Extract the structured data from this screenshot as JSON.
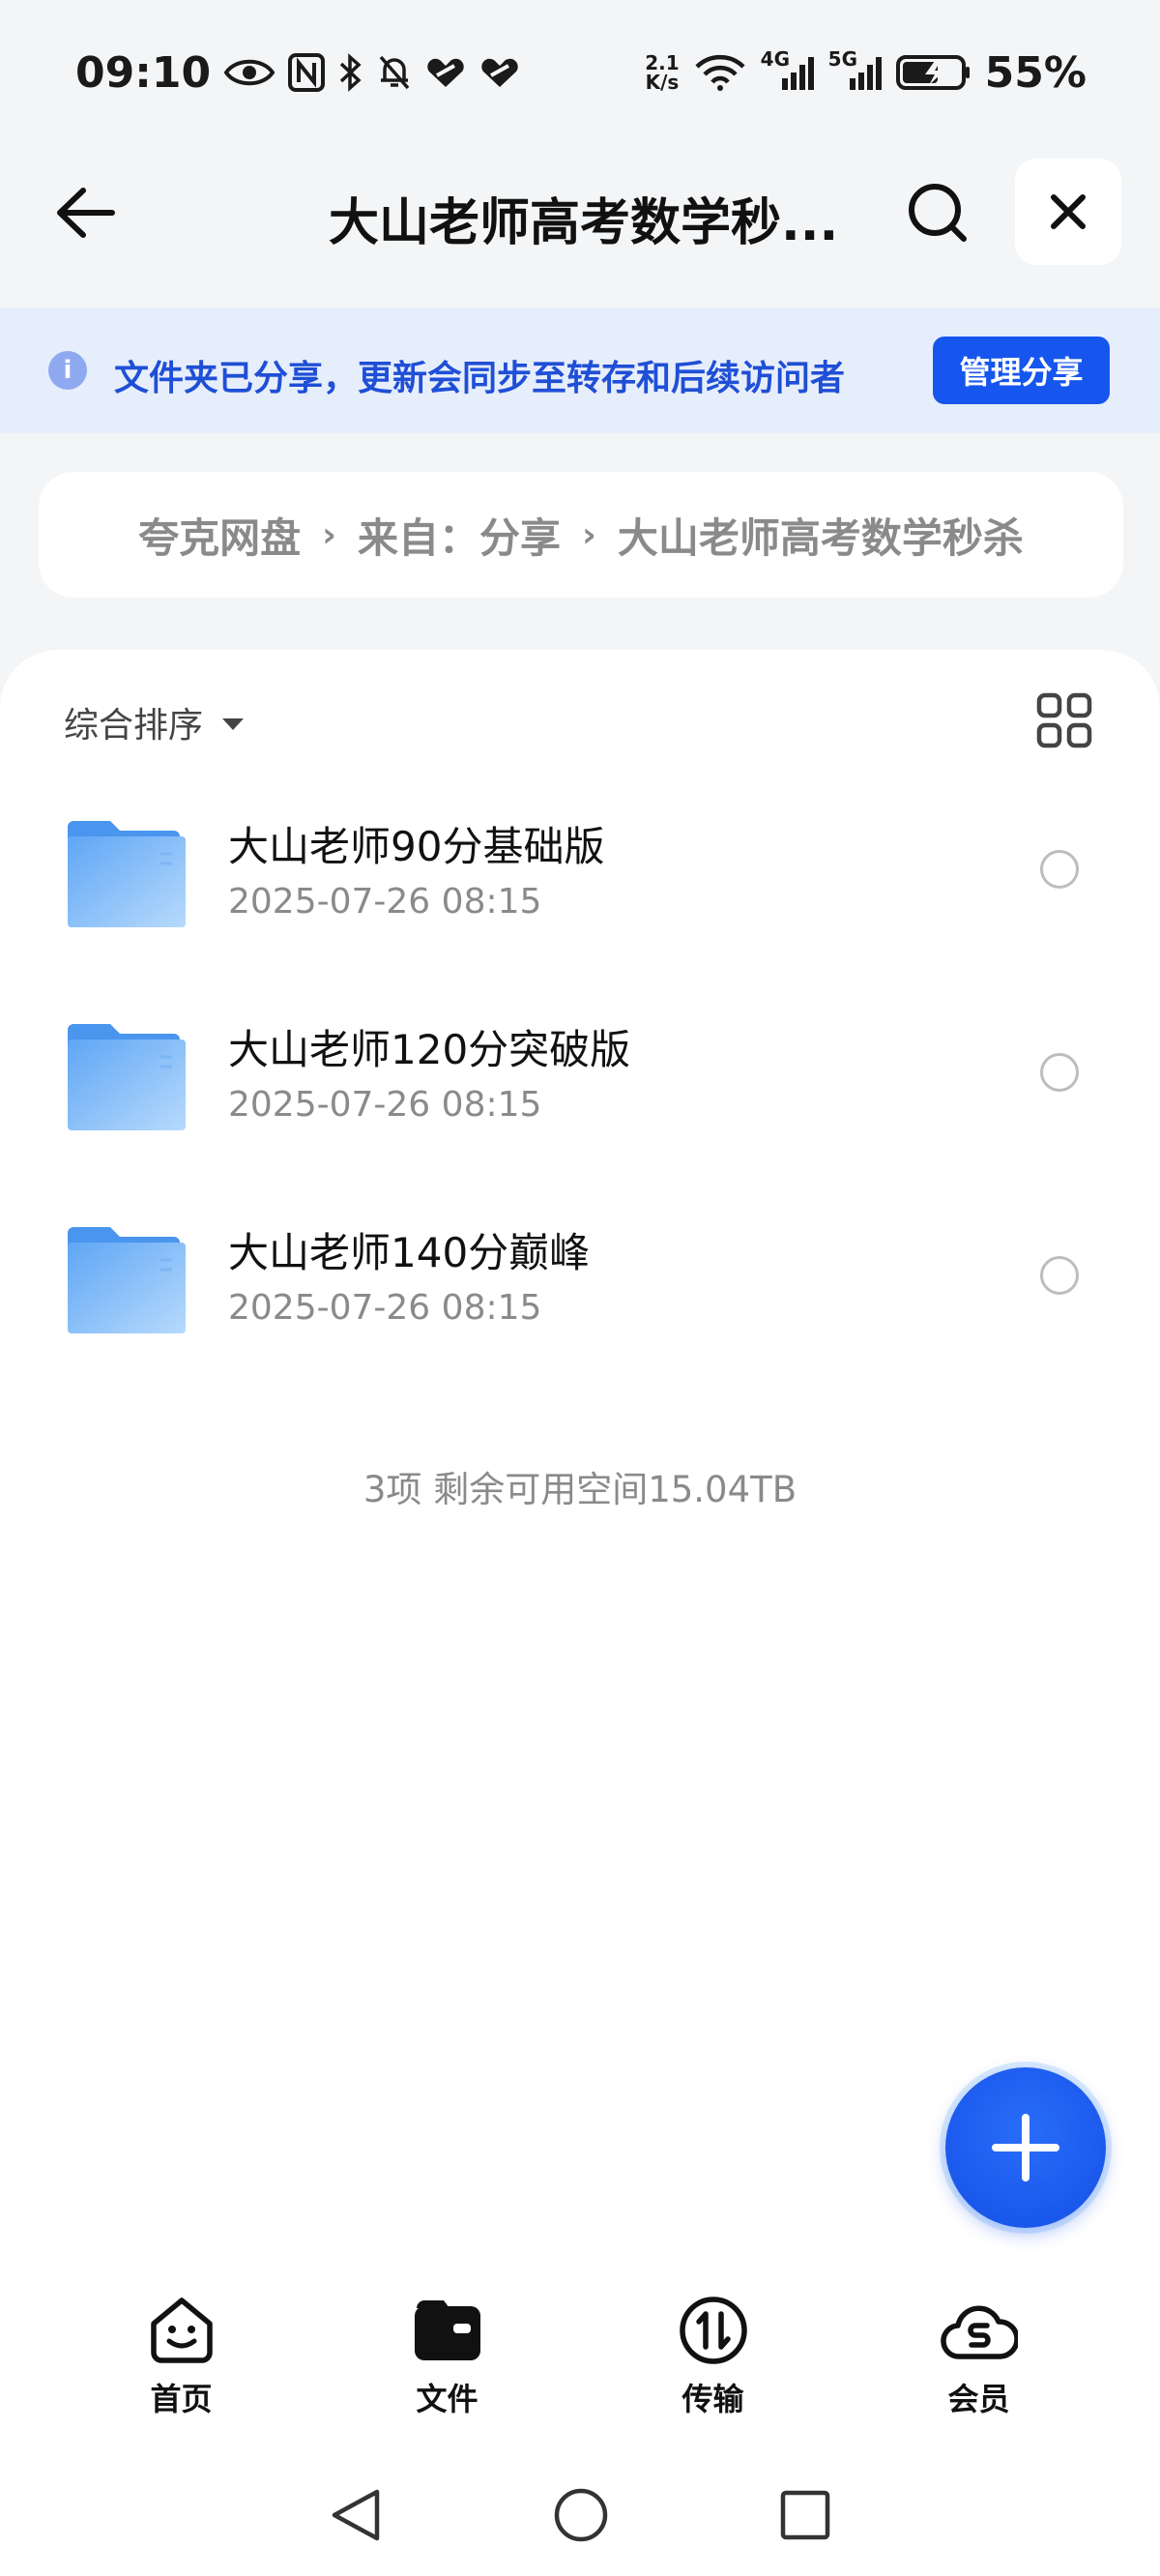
{
  "status_bar": {
    "time": "09:10",
    "net_speed_top": "2.1",
    "net_speed_bottom": "K/s",
    "net_4g": "4G",
    "net_5g": "5G",
    "battery": "55%"
  },
  "header": {
    "title": "大山老师高考数学秒..."
  },
  "share_banner": {
    "info_glyph": "i",
    "text": "文件夹已分享，更新会同步至转存和后续访问者",
    "manage_button": "管理分享"
  },
  "breadcrumb": {
    "items": [
      "夸克网盘",
      "来自：分享",
      "大山老师高考数学秒杀"
    ],
    "separator": "›"
  },
  "sort": {
    "label": "综合排序"
  },
  "files": [
    {
      "name": "大山老师90分基础版",
      "date": "2025-07-26 08:15"
    },
    {
      "name": "大山老师120分突破版",
      "date": "2025-07-26 08:15"
    },
    {
      "name": "大山老师140分巅峰",
      "date": "2025-07-26 08:15"
    }
  ],
  "summary": "3项 剩余可用空间15.04TB",
  "bottom_nav": {
    "items": [
      {
        "label": "首页",
        "icon": "home-smile-icon"
      },
      {
        "label": "文件",
        "icon": "files-wallet-icon"
      },
      {
        "label": "传输",
        "icon": "transfer-icon"
      },
      {
        "label": "会员",
        "icon": "member-cloud-icon"
      }
    ]
  },
  "colors": {
    "accent": "#1656EE",
    "banner_bg": "#E7EEFB",
    "banner_text": "#1F4FD6",
    "folder": "#5FA6F5"
  }
}
